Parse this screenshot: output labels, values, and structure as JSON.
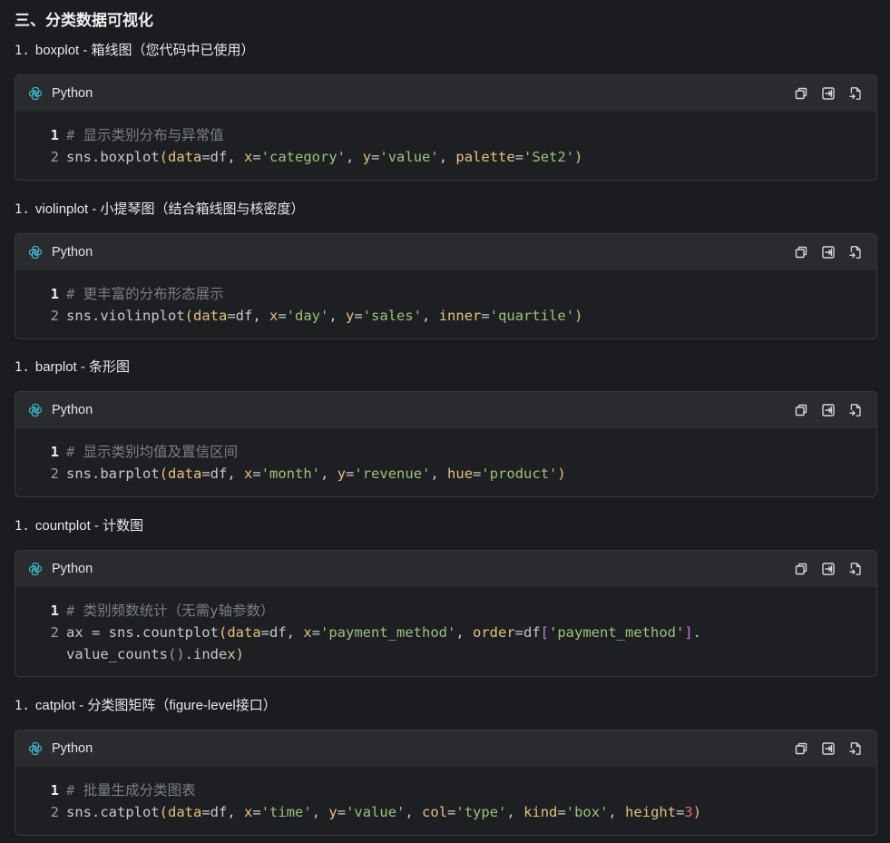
{
  "section_title": "三、分类数据可视化",
  "blocks": [
    {
      "heading_num": "1.",
      "heading_text": "boxplot - 箱线图（您代码中已使用）",
      "lang": "Python",
      "lines": [
        {
          "n": "1",
          "tokens": [
            {
              "t": "comment",
              "v": "# 显示类别分布与异常值"
            }
          ]
        },
        {
          "n": "2",
          "tokens": [
            {
              "t": "plain",
              "v": "sns.boxplot"
            },
            {
              "t": "paren",
              "v": "("
            },
            {
              "t": "param",
              "v": "data"
            },
            {
              "t": "plain",
              "v": "=df, "
            },
            {
              "t": "param",
              "v": "x"
            },
            {
              "t": "plain",
              "v": "="
            },
            {
              "t": "string",
              "v": "'category'"
            },
            {
              "t": "plain",
              "v": ", "
            },
            {
              "t": "param",
              "v": "y"
            },
            {
              "t": "plain",
              "v": "="
            },
            {
              "t": "string",
              "v": "'value'"
            },
            {
              "t": "plain",
              "v": ", "
            },
            {
              "t": "param",
              "v": "palette"
            },
            {
              "t": "plain",
              "v": "="
            },
            {
              "t": "string",
              "v": "'Set2'"
            },
            {
              "t": "paren",
              "v": ")"
            }
          ]
        }
      ]
    },
    {
      "heading_num": "1.",
      "heading_text": "violinplot - 小提琴图（结合箱线图与核密度）",
      "lang": "Python",
      "lines": [
        {
          "n": "1",
          "tokens": [
            {
              "t": "comment",
              "v": "# 更丰富的分布形态展示"
            }
          ]
        },
        {
          "n": "2",
          "tokens": [
            {
              "t": "plain",
              "v": "sns.violinplot"
            },
            {
              "t": "paren",
              "v": "("
            },
            {
              "t": "param",
              "v": "data"
            },
            {
              "t": "plain",
              "v": "=df, "
            },
            {
              "t": "param",
              "v": "x"
            },
            {
              "t": "plain",
              "v": "="
            },
            {
              "t": "string",
              "v": "'day'"
            },
            {
              "t": "plain",
              "v": ", "
            },
            {
              "t": "param",
              "v": "y"
            },
            {
              "t": "plain",
              "v": "="
            },
            {
              "t": "string",
              "v": "'sales'"
            },
            {
              "t": "plain",
              "v": ", "
            },
            {
              "t": "param",
              "v": "inner"
            },
            {
              "t": "plain",
              "v": "="
            },
            {
              "t": "string",
              "v": "'quartile'"
            },
            {
              "t": "paren",
              "v": ")"
            }
          ]
        }
      ]
    },
    {
      "heading_num": "1.",
      "heading_text": "barplot - 条形图",
      "lang": "Python",
      "lines": [
        {
          "n": "1",
          "tokens": [
            {
              "t": "comment",
              "v": "# 显示类别均值及置信区间"
            }
          ]
        },
        {
          "n": "2",
          "tokens": [
            {
              "t": "plain",
              "v": "sns.barplot"
            },
            {
              "t": "paren",
              "v": "("
            },
            {
              "t": "param",
              "v": "data"
            },
            {
              "t": "plain",
              "v": "=df, "
            },
            {
              "t": "param",
              "v": "x"
            },
            {
              "t": "plain",
              "v": "="
            },
            {
              "t": "string",
              "v": "'month'"
            },
            {
              "t": "plain",
              "v": ", "
            },
            {
              "t": "param",
              "v": "y"
            },
            {
              "t": "plain",
              "v": "="
            },
            {
              "t": "string",
              "v": "'revenue'"
            },
            {
              "t": "plain",
              "v": ", "
            },
            {
              "t": "param",
              "v": "hue"
            },
            {
              "t": "plain",
              "v": "="
            },
            {
              "t": "string",
              "v": "'product'"
            },
            {
              "t": "paren",
              "v": ")"
            }
          ]
        }
      ]
    },
    {
      "heading_num": "1.",
      "heading_text": "countplot - 计数图",
      "lang": "Python",
      "lines": [
        {
          "n": "1",
          "tokens": [
            {
              "t": "comment",
              "v": "# 类别频数统计（无需y轴参数）"
            }
          ]
        },
        {
          "n": "2",
          "tokens": [
            {
              "t": "plain",
              "v": "ax = sns.countplot"
            },
            {
              "t": "paren",
              "v": "("
            },
            {
              "t": "param",
              "v": "data"
            },
            {
              "t": "plain",
              "v": "=df, "
            },
            {
              "t": "param",
              "v": "x"
            },
            {
              "t": "plain",
              "v": "="
            },
            {
              "t": "string",
              "v": "'payment_method'"
            },
            {
              "t": "plain",
              "v": ", "
            },
            {
              "t": "param",
              "v": "order"
            },
            {
              "t": "plain",
              "v": "=df"
            },
            {
              "t": "bracket",
              "v": "["
            },
            {
              "t": "string",
              "v": "'payment_method'"
            },
            {
              "t": "bracket",
              "v": "]"
            },
            {
              "t": "plain",
              "v": "."
            }
          ]
        },
        {
          "n": "",
          "tokens": [
            {
              "t": "plain",
              "v": "value_counts"
            },
            {
              "t": "bracket",
              "v": "()"
            },
            {
              "t": "plain",
              "v": ".index"
            },
            {
              "t": "paren",
              "v": ")"
            }
          ]
        }
      ]
    },
    {
      "heading_num": "1.",
      "heading_text": "catplot - 分类图矩阵（figure-level接口）",
      "lang": "Python",
      "lines": [
        {
          "n": "1",
          "tokens": [
            {
              "t": "comment",
              "v": "# 批量生成分类图表"
            }
          ]
        },
        {
          "n": "2",
          "tokens": [
            {
              "t": "plain",
              "v": "sns.catplot"
            },
            {
              "t": "paren",
              "v": "("
            },
            {
              "t": "param",
              "v": "data"
            },
            {
              "t": "plain",
              "v": "=df, "
            },
            {
              "t": "param",
              "v": "x"
            },
            {
              "t": "plain",
              "v": "="
            },
            {
              "t": "string",
              "v": "'time'"
            },
            {
              "t": "plain",
              "v": ", "
            },
            {
              "t": "param",
              "v": "y"
            },
            {
              "t": "plain",
              "v": "="
            },
            {
              "t": "string",
              "v": "'value'"
            },
            {
              "t": "plain",
              "v": ", "
            },
            {
              "t": "param",
              "v": "col"
            },
            {
              "t": "plain",
              "v": "="
            },
            {
              "t": "string",
              "v": "'type'"
            },
            {
              "t": "plain",
              "v": ", "
            },
            {
              "t": "param",
              "v": "kind"
            },
            {
              "t": "plain",
              "v": "="
            },
            {
              "t": "string",
              "v": "'box'"
            },
            {
              "t": "plain",
              "v": ", "
            },
            {
              "t": "param",
              "v": "height"
            },
            {
              "t": "plain",
              "v": "="
            },
            {
              "t": "number",
              "v": "3"
            },
            {
              "t": "paren",
              "v": ")"
            }
          ]
        }
      ]
    }
  ],
  "icons": {
    "language": "python-icon",
    "copy": "copy-icon",
    "insert": "insert-icon",
    "new_file": "new-file-icon"
  },
  "colors": {
    "background": "#1b1c1f",
    "header": "#2a2b2f",
    "comment": "#7a7f86",
    "param": "#e5c07b",
    "string": "#98c379",
    "number": "#e06c75",
    "python_icon": "#3fb6c9"
  }
}
